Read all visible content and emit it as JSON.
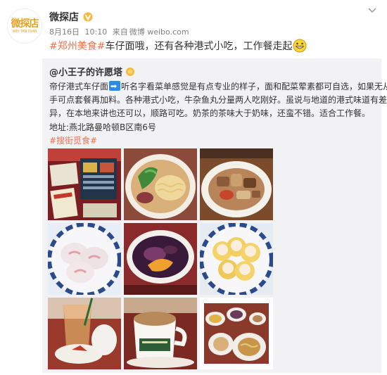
{
  "post": {
    "account_name": "微探店",
    "avatar_logo_main": "微探店",
    "avatar_logo_sub": "WEI TAN DIAN",
    "date": "8月16日",
    "time": "10:10",
    "source_prefix": "来自",
    "source": "微博 weibo.com",
    "tag": "#郑州美食#",
    "text": "车仔面哦，还有各种港式小吃，工作餐走起",
    "emoji": "grinning-face-emoji"
  },
  "repost": {
    "author": "@小王子的许愿塔",
    "line1_a": "帝仔港式车仔面",
    "line1_b": "听名字看菜单感觉是有点专业的样子，面和配菜荤素都可自选，如果无从下",
    "line2": "手可点套餐再加料。各种港式小吃，牛杂鱼丸分量两人吃刚好。虽说与地道的港式味道有差",
    "line3": "异，在本地来讲也还可以，顺路可吃。奶茶的茶味大于奶味，还蛮不错。适合工作餐。",
    "address": "地址:燕北路曼哈顿B区南6号",
    "tag": "#搜街觅食#"
  },
  "photos": [
    {
      "name": "photo-menu-table",
      "desc": "menu"
    },
    {
      "name": "photo-noodle-soup",
      "desc": "noodles"
    },
    {
      "name": "photo-beef-offal",
      "desc": "offal"
    },
    {
      "name": "photo-shrimp-dumplings",
      "desc": "dumplings"
    },
    {
      "name": "photo-dessert-bowl",
      "desc": "dessert"
    },
    {
      "name": "photo-siu-mai",
      "desc": "siumai"
    },
    {
      "name": "photo-milk-tea-glass",
      "desc": "milktea"
    },
    {
      "name": "photo-milk-tea-cup",
      "desc": "teacup"
    },
    {
      "name": "photo-table-spread",
      "desc": "spread"
    }
  ],
  "colors": {
    "tag": "#eb7350",
    "verified": "#f6b93a",
    "repost_bg": "#f2f2f5",
    "meta": "#808080"
  }
}
